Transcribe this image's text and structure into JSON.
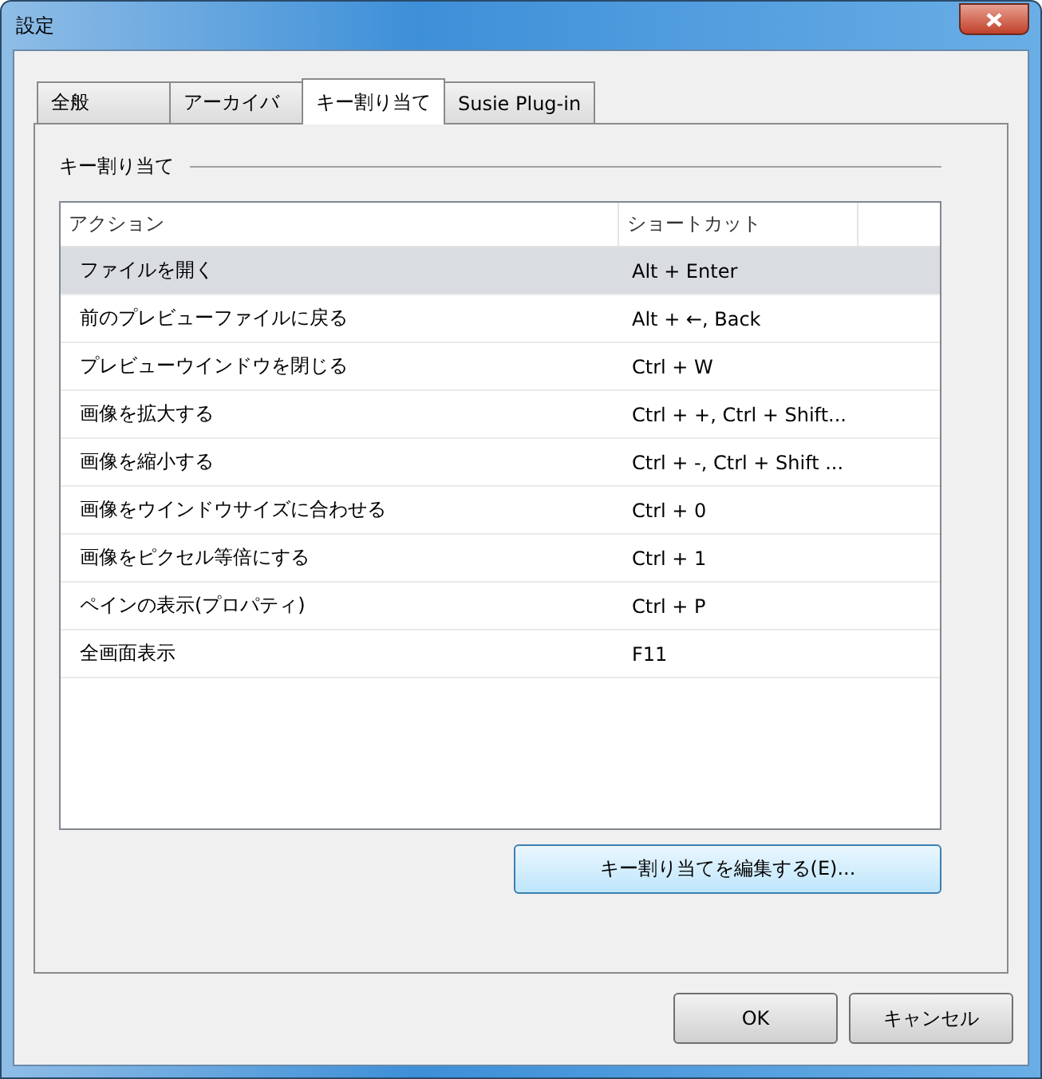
{
  "window": {
    "title": "設定"
  },
  "tabs": [
    {
      "label": "全般",
      "selected": false
    },
    {
      "label": "アーカイバ",
      "selected": false
    },
    {
      "label": "キー割り当て",
      "selected": true
    },
    {
      "label": "Susie Plug-in",
      "selected": false
    }
  ],
  "group": {
    "title": "キー割り当て"
  },
  "table": {
    "columns": [
      "アクション",
      "ショートカット"
    ],
    "rows": [
      {
        "action": "ファイルを開く",
        "shortcut": "Alt + Enter",
        "selected": true
      },
      {
        "action": "前のプレビューファイルに戻る",
        "shortcut": "Alt + ←, Back",
        "selected": false
      },
      {
        "action": "プレビューウインドウを閉じる",
        "shortcut": "Ctrl + W",
        "selected": false
      },
      {
        "action": "画像を拡大する",
        "shortcut": "Ctrl + +, Ctrl + Shift...",
        "selected": false
      },
      {
        "action": "画像を縮小する",
        "shortcut": "Ctrl + -, Ctrl + Shift ...",
        "selected": false
      },
      {
        "action": "画像をウインドウサイズに合わせる",
        "shortcut": "Ctrl + 0",
        "selected": false
      },
      {
        "action": "画像をピクセル等倍にする",
        "shortcut": "Ctrl + 1",
        "selected": false
      },
      {
        "action": "ペインの表示(プロパティ)",
        "shortcut": "Ctrl + P",
        "selected": false
      },
      {
        "action": "全画面表示",
        "shortcut": "F11",
        "selected": false
      }
    ]
  },
  "edit_button": "キー割り当てを編集する(E)...",
  "buttons": [
    "OK",
    "キャンセル"
  ]
}
